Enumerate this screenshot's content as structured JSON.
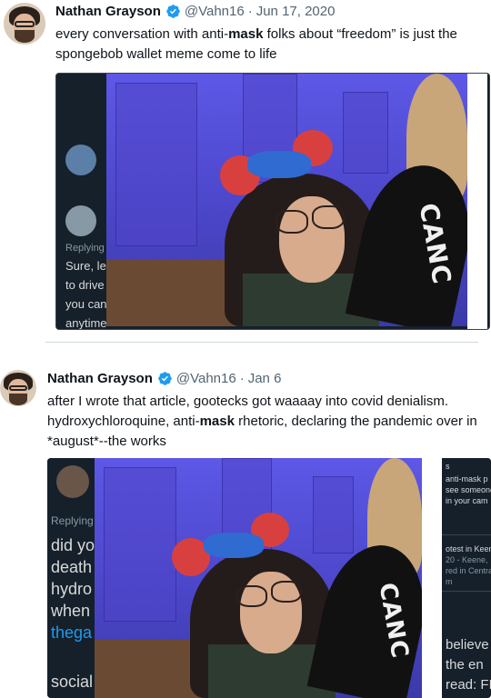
{
  "tweets": [
    {
      "author_name": "Nathan Grayson",
      "handle": "@Vahn16",
      "date": "Jun 17, 2020",
      "text_before": "every conversation with anti-",
      "text_bold": "mask",
      "text_after": " folks about “freedom” is just the spongebob wallet meme come to life",
      "embed": {
        "left_column_texts": [
          "Replying",
          "Sure, le",
          "to drive",
          "you can",
          "anytime"
        ],
        "fan_text": "CANC",
        "icons": [
          "avatar-icon",
          "default-avatar-icon"
        ]
      }
    },
    {
      "author_name": "Nathan Grayson",
      "handle": "@Vahn16",
      "date": "Jan 6",
      "text_before": "after I wrote that article, gootecks got waaaay into covid denialism. hydroxychloroquine, anti-",
      "text_bold": "mask",
      "text_after": " rhetoric, declaring the pandemic over in *august*--the works",
      "embed": {
        "left_column_texts": [
          "Replying",
          "did yo",
          "death",
          "hydro",
          "when",
          "thega",
          "social"
        ],
        "right_card_top": [
          "s",
          "anti-mask p",
          "see someone",
          "in your cam"
        ],
        "right_card_mid": [
          "otest in Keen",
          "20 - Keene,",
          "red in Centra",
          "m"
        ],
        "right_card_bottom": [
          "believe",
          "the en",
          "read: FI"
        ],
        "fan_text": "CANC"
      }
    }
  ],
  "colors": {
    "verified_blue": "#1d9bf0",
    "link_blue": "#1d9bf0",
    "dark_bg": "#15202b"
  }
}
